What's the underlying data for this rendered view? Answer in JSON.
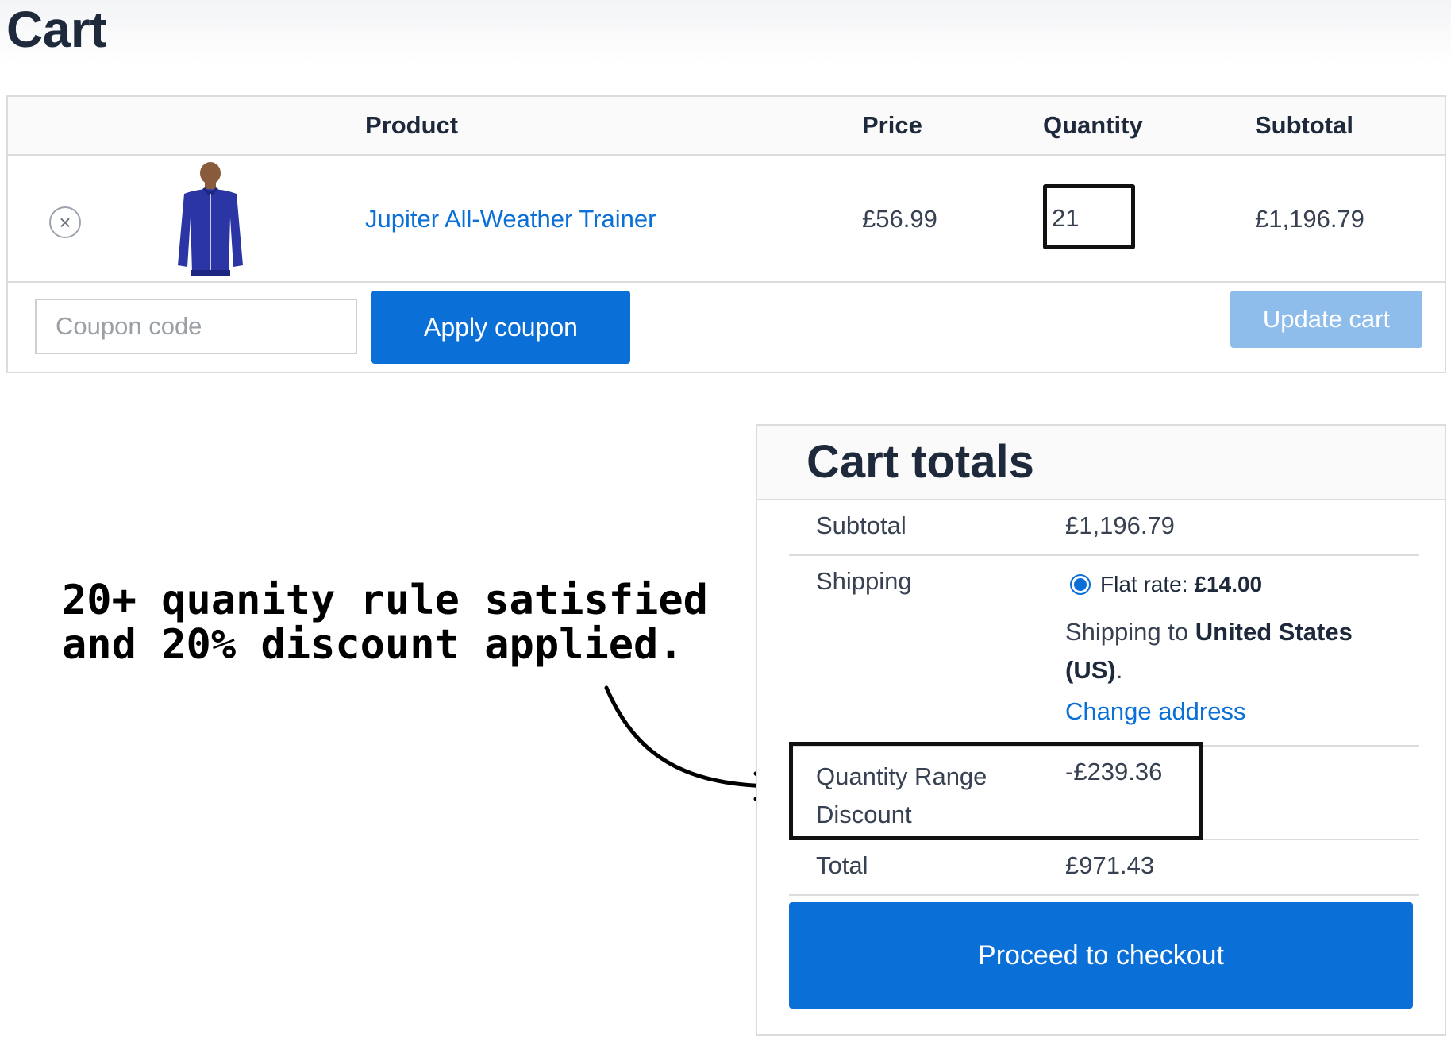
{
  "page": {
    "title": "Cart"
  },
  "cart": {
    "headers": {
      "product": "Product",
      "price": "Price",
      "quantity": "Quantity",
      "subtotal": "Subtotal"
    },
    "items": [
      {
        "name": "Jupiter All-Weather Trainer",
        "price": "£56.99",
        "quantity": "21",
        "subtotal": "£1,196.79"
      }
    ],
    "coupon": {
      "placeholder": "Coupon code",
      "value": ""
    },
    "apply_coupon_label": "Apply coupon",
    "update_cart_label": "Update cart"
  },
  "annotation": {
    "text": "20+ quanity rule satisfied\nand 20% discount applied."
  },
  "totals": {
    "title": "Cart totals",
    "subtotal_label": "Subtotal",
    "subtotal_value": "£1,196.79",
    "shipping_label": "Shipping",
    "shipping_option_label": "Flat rate:",
    "shipping_option_price": "£14.00",
    "shipping_to_prefix": "Shipping to",
    "shipping_destination": "United States (US)",
    "shipping_to_suffix": ".",
    "change_address_label": "Change address",
    "discount_label": "Quantity Range Discount",
    "discount_value": "-£239.36",
    "total_label": "Total",
    "total_value": "£971.43",
    "checkout_label": "Proceed to checkout"
  },
  "colors": {
    "accent": "#0a6fd6",
    "disabled_button": "#8fbdeb",
    "highlight_border": "#111111"
  }
}
